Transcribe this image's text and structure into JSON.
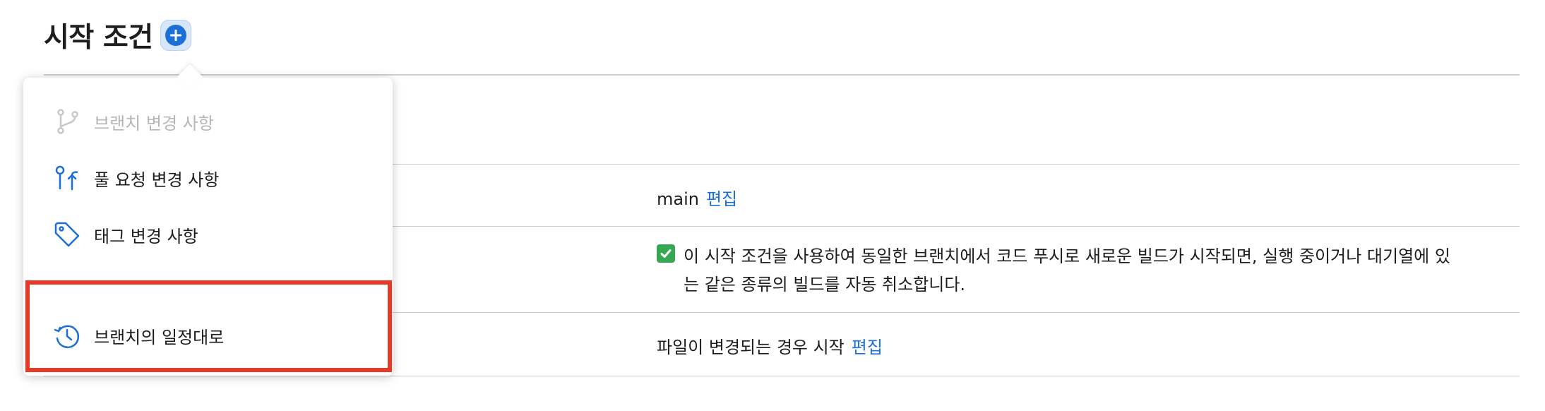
{
  "section": {
    "title": "시작 조건",
    "add_icon": "plus-circle-icon"
  },
  "rows": {
    "branch_value": "main",
    "branch_edit": "편집",
    "auto_cancel_text": "이 시작 조건을 사용하여 동일한 브랜치에서 코드 푸시로 새로운 빌드가 시작되면, 실행 중이거나 대기열에 있는 같은 종류의 빌드를 자동 취소합니다.",
    "auto_cancel_checked": true,
    "file_change_value": "파일이 변경되는 경우 시작",
    "file_change_edit": "편집"
  },
  "menu": {
    "items": [
      {
        "label": "브랜치 변경 사항",
        "icon": "branch-icon",
        "disabled": true
      },
      {
        "label": "풀 요청 변경 사항",
        "icon": "pull-request-icon",
        "disabled": false
      },
      {
        "label": "태그 변경 사항",
        "icon": "tag-icon",
        "disabled": false
      },
      {
        "label": "브랜치의 일정대로",
        "icon": "schedule-history-icon",
        "disabled": false
      }
    ]
  },
  "colors": {
    "accent": "#1d6fd8",
    "highlight": "#e43a27",
    "check": "#34a853"
  }
}
